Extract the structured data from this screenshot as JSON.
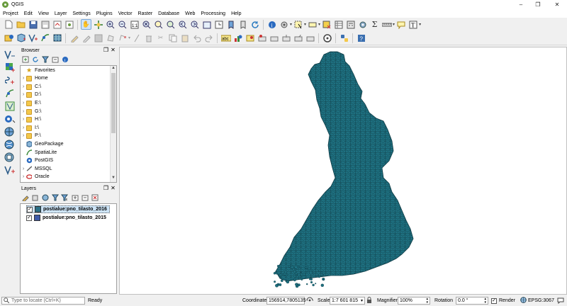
{
  "window": {
    "title": "QGIS",
    "minimize": "–",
    "maximize": "❐",
    "close": "✕"
  },
  "menu": [
    "Project",
    "Edit",
    "View",
    "Layer",
    "Settings",
    "Plugins",
    "Vector",
    "Raster",
    "Database",
    "Web",
    "Processing",
    "Help"
  ],
  "browser": {
    "title": "Browser",
    "items": [
      {
        "label": "Favorites",
        "icon": "star-icon",
        "expand": false
      },
      {
        "label": "Home",
        "icon": "folder-icon",
        "expand": true
      },
      {
        "label": "C:\\",
        "icon": "folder-icon",
        "expand": true
      },
      {
        "label": "D:\\",
        "icon": "folder-icon",
        "expand": true
      },
      {
        "label": "E:\\",
        "icon": "folder-icon",
        "expand": true
      },
      {
        "label": "G:\\",
        "icon": "folder-icon",
        "expand": true
      },
      {
        "label": "H:\\",
        "icon": "folder-icon",
        "expand": true
      },
      {
        "label": "I:\\",
        "icon": "folder-icon",
        "expand": true
      },
      {
        "label": "P:\\",
        "icon": "folder-icon",
        "expand": true
      },
      {
        "label": "GeoPackage",
        "icon": "geopackage-icon",
        "expand": false
      },
      {
        "label": "SpatiaLite",
        "icon": "spatialite-icon",
        "expand": false
      },
      {
        "label": "PostGIS",
        "icon": "postgis-icon",
        "expand": false
      },
      {
        "label": "MSSQL",
        "icon": "mssql-icon",
        "expand": true
      },
      {
        "label": "Oracle",
        "icon": "oracle-icon",
        "expand": true
      }
    ]
  },
  "layers": {
    "title": "Layers",
    "items": [
      {
        "label": "postialue:pno_tilasto_2016",
        "checked": true,
        "selected": true,
        "color": "#2b6f86"
      },
      {
        "label": "postialue:pno_tilasto_2015",
        "checked": true,
        "selected": false,
        "color": "#3f5aa8"
      }
    ]
  },
  "map": {
    "fill": "#1e7080",
    "stroke": "#0e3a44"
  },
  "status": {
    "locator_placeholder": "Type to locate (Ctrl+K)",
    "ready": "Ready",
    "coordinate_label": "Coordinate",
    "coordinate_value": "156914,7805135",
    "scale_label": "Scale",
    "scale_value": "1:7 601 815",
    "magnifier_label": "Magnifier",
    "magnifier_value": "100%",
    "rotation_label": "Rotation",
    "rotation_value": "0.0 °",
    "render_label": "Render",
    "render_checked": true,
    "crs": "EPSG:3067"
  }
}
